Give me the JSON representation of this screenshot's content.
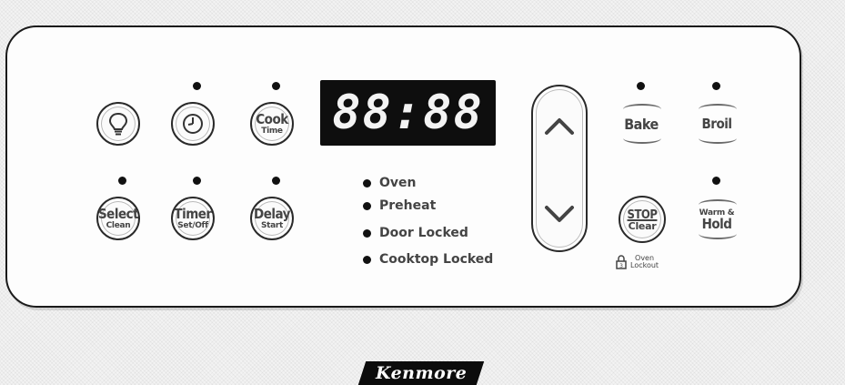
{
  "display": {
    "time": "88:88"
  },
  "buttons": {
    "light": {
      "icon": "lightbulb-icon"
    },
    "clock": {
      "icon": "clock-icon"
    },
    "cook_time": {
      "main": "Cook",
      "sub": "Time"
    },
    "select_clean": {
      "main": "Select",
      "sub": "Clean"
    },
    "timer": {
      "main": "Timer",
      "sub": "Set/Off"
    },
    "delay": {
      "main": "Delay",
      "sub": "Start"
    },
    "bake": {
      "main": "Bake"
    },
    "broil": {
      "main": "Broil"
    },
    "stop_clear": {
      "main": "STOP",
      "sub": "Clear"
    },
    "warm_hold": {
      "top": "Warm &",
      "main": "Hold"
    }
  },
  "indicators": [
    "Oven",
    "Preheat",
    "Door Locked",
    "Cooktop Locked"
  ],
  "lockout": {
    "line1": "Oven",
    "line2": "Lockout",
    "icon": "lock-icon"
  },
  "arrows": {
    "up": "up-arrow-icon",
    "down": "down-arrow-icon"
  },
  "brand": "Kenmore"
}
